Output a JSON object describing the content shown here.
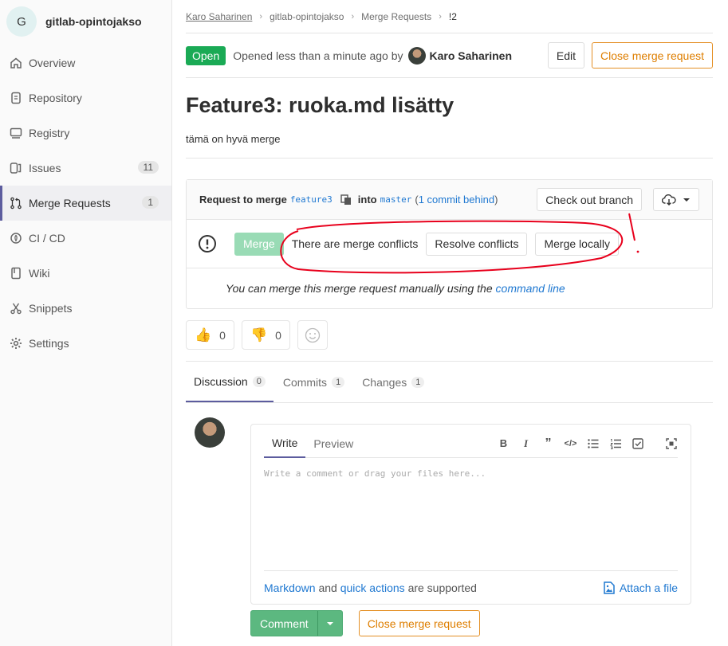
{
  "sidebar": {
    "avatar_letter": "G",
    "project_name": "gitlab-opintojakso",
    "items": [
      {
        "label": "Overview",
        "icon": "home-icon"
      },
      {
        "label": "Repository",
        "icon": "doc-icon"
      },
      {
        "label": "Registry",
        "icon": "container-icon"
      },
      {
        "label": "Issues",
        "icon": "issues-icon",
        "count": "11"
      },
      {
        "label": "Merge Requests",
        "icon": "merge-request-icon",
        "count": "1"
      },
      {
        "label": "CI / CD",
        "icon": "rocket-icon"
      },
      {
        "label": "Wiki",
        "icon": "book-icon"
      },
      {
        "label": "Snippets",
        "icon": "scissors-icon"
      },
      {
        "label": "Settings",
        "icon": "gear-icon"
      }
    ],
    "active_item": "Merge Requests"
  },
  "breadcrumb": [
    "Karo Saharinen",
    "gitlab-opintojakso",
    "Merge Requests",
    "!2"
  ],
  "header": {
    "status": "Open",
    "opened_text": "Opened less than a minute ago by",
    "author": "Karo Saharinen",
    "edit_label": "Edit",
    "close_label": "Close merge request"
  },
  "title": "Feature3: ruoka.md lisätty",
  "description": "tämä on hyvä merge",
  "widget": {
    "request_to_merge": "Request to merge",
    "source_branch": "feature3",
    "into": "into",
    "target_branch": "master",
    "commit_behind": "1 commit behind",
    "checkout_label": "Check out branch",
    "merge_label": "Merge",
    "conflict_text": "There are merge conflicts",
    "resolve_label": "Resolve conflicts",
    "merge_locally_label": "Merge locally",
    "manual_text": "You can merge this merge request manually using the",
    "command_line": "command line"
  },
  "awards": {
    "thumbsup": "0",
    "thumbsdown": "0"
  },
  "tabs": [
    {
      "label": "Discussion",
      "count": "0"
    },
    {
      "label": "Commits",
      "count": "1"
    },
    {
      "label": "Changes",
      "count": "1"
    }
  ],
  "editor": {
    "write_label": "Write",
    "preview_label": "Preview",
    "placeholder": "Write a comment or drag your files here...",
    "markdown": "Markdown",
    "and": "and",
    "quick_actions": "quick actions",
    "supported": "are supported",
    "attach": "Attach a file"
  },
  "actions": {
    "comment_label": "Comment",
    "close_label": "Close merge request"
  },
  "colors": {
    "open_badge": "#1aaa55",
    "warning": "#e48f24",
    "annotation": "#e8001c",
    "link": "#1f78d1"
  }
}
